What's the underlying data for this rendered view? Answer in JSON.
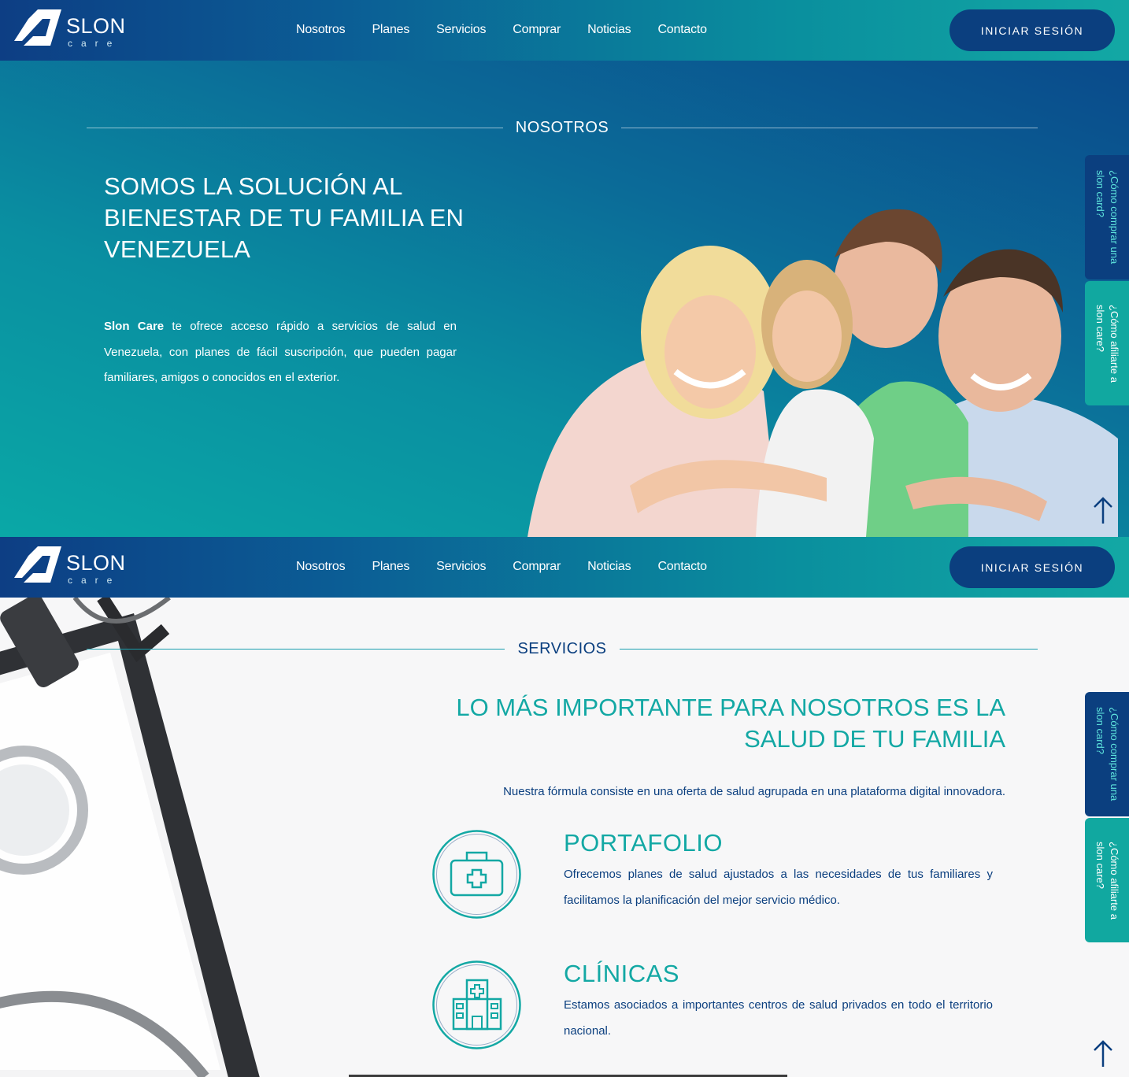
{
  "brand": {
    "name": "SLON",
    "sub": "care"
  },
  "nav": [
    "Nosotros",
    "Planes",
    "Servicios",
    "Comprar",
    "Noticias",
    "Contacto"
  ],
  "login_label": "INICIAR SESIÓN",
  "hero": {
    "section_title": "NOSOTROS",
    "heading": "SOMOS LA SOLUCIÓN AL BIENESTAR DE TU FAMILIA EN VENEZUELA",
    "text_bold": "Slon Care",
    "text_rest": " te ofrece acceso rápido a servicios de salud en Venezuela, con planes de fácil suscripción, que pueden pagar familiares, amigos o conocidos en el exterior."
  },
  "side_tabs": {
    "buy": "¿Cómo comprar una\nslon card?",
    "affiliate": "¿Cómo afiliarte a\nslon care?"
  },
  "services": {
    "section_title": "SERVICIOS",
    "heading": "LO MÁS IMPORTANTE PARA NOSOTROS ES LA SALUD DE TU FAMILIA",
    "subtitle": "Nuestra fórmula consiste en una oferta de salud agrupada en una plataforma digital innovadora.",
    "features": [
      {
        "title": "PORTAFOLIO",
        "text": "Ofrecemos planes de salud ajustados a las necesidades de tus familiares y facilitamos la planificación del mejor servicio médico.",
        "icon": "first-aid-kit-icon"
      },
      {
        "title": "CLÍNICAS",
        "text": "Estamos asociados a importantes centros de salud privados en todo el territorio nacional.",
        "icon": "hospital-icon"
      }
    ]
  },
  "colors": {
    "navy": "#0b3f7f",
    "teal": "#13a8a4",
    "accent_text": "#5ee3dc"
  }
}
